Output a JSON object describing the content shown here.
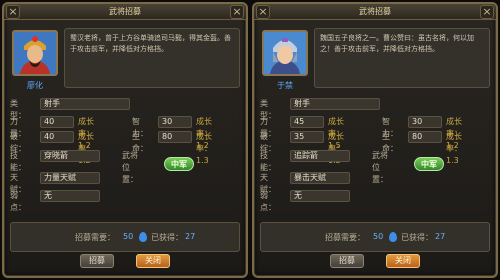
{
  "left": {
    "window_title": "武将招募",
    "close_symbol": "×",
    "hero_name": "廖化",
    "description": "蜀汉老将，曾于上方谷单骑追司马懿，得其金盔。善于攻击前军，并降低对方格挡。",
    "type_label": "类型：",
    "type_value": "射手",
    "str_label": "力量：",
    "str_value": "40",
    "str_growth": "成长率：1.2",
    "int_label": "智力：",
    "int_value": "30",
    "int_growth": "成长率：1.2",
    "brk_label": "破绽：",
    "brk_value": "40",
    "brk_growth": "成长率：1.2",
    "hp_label": "生命：",
    "hp_value": "80",
    "hp_growth": "成长率：1.3",
    "skill_label": "技能：",
    "skill_value": "穿晓箭",
    "pos_label": "武将位置：",
    "pos_value": "中军",
    "talent_label": "天赋：",
    "talent_value": "力量天赋",
    "weak_label": "弱点：",
    "weak_value": "无",
    "cost_label": "招募需要：",
    "cost_value": "50",
    "owned_label": "已获得：",
    "owned_value": "27",
    "recruit_button": "招募",
    "close_button": "关闭"
  },
  "right": {
    "window_title": "武将招募",
    "close_symbol": "×",
    "hero_name": "于禁",
    "description": "魏国五子良将之一。曹公赞曰：虽古名将，何以加之！善于攻击前军，并降低对方格挡。",
    "type_label": "类型：",
    "type_value": "射手",
    "str_label": "力量：",
    "str_value": "45",
    "str_growth": "成长率：1.5",
    "int_label": "智力：",
    "int_value": "30",
    "int_growth": "成长率：1.2",
    "brk_label": "破绽：",
    "brk_value": "35",
    "brk_growth": "成长率：1.2",
    "hp_label": "生命：",
    "hp_value": "80",
    "hp_growth": "成长率：1.3",
    "skill_label": "技能：",
    "skill_value": "追踪箭",
    "pos_label": "武将位置：",
    "pos_value": "中军",
    "talent_label": "天赋：",
    "talent_value": "暴击天赋",
    "weak_label": "弱点：",
    "weak_value": "无",
    "cost_label": "招募需要：",
    "cost_value": "50",
    "owned_label": "已获得：",
    "owned_value": "27",
    "recruit_button": "招募",
    "close_button": "关闭"
  }
}
